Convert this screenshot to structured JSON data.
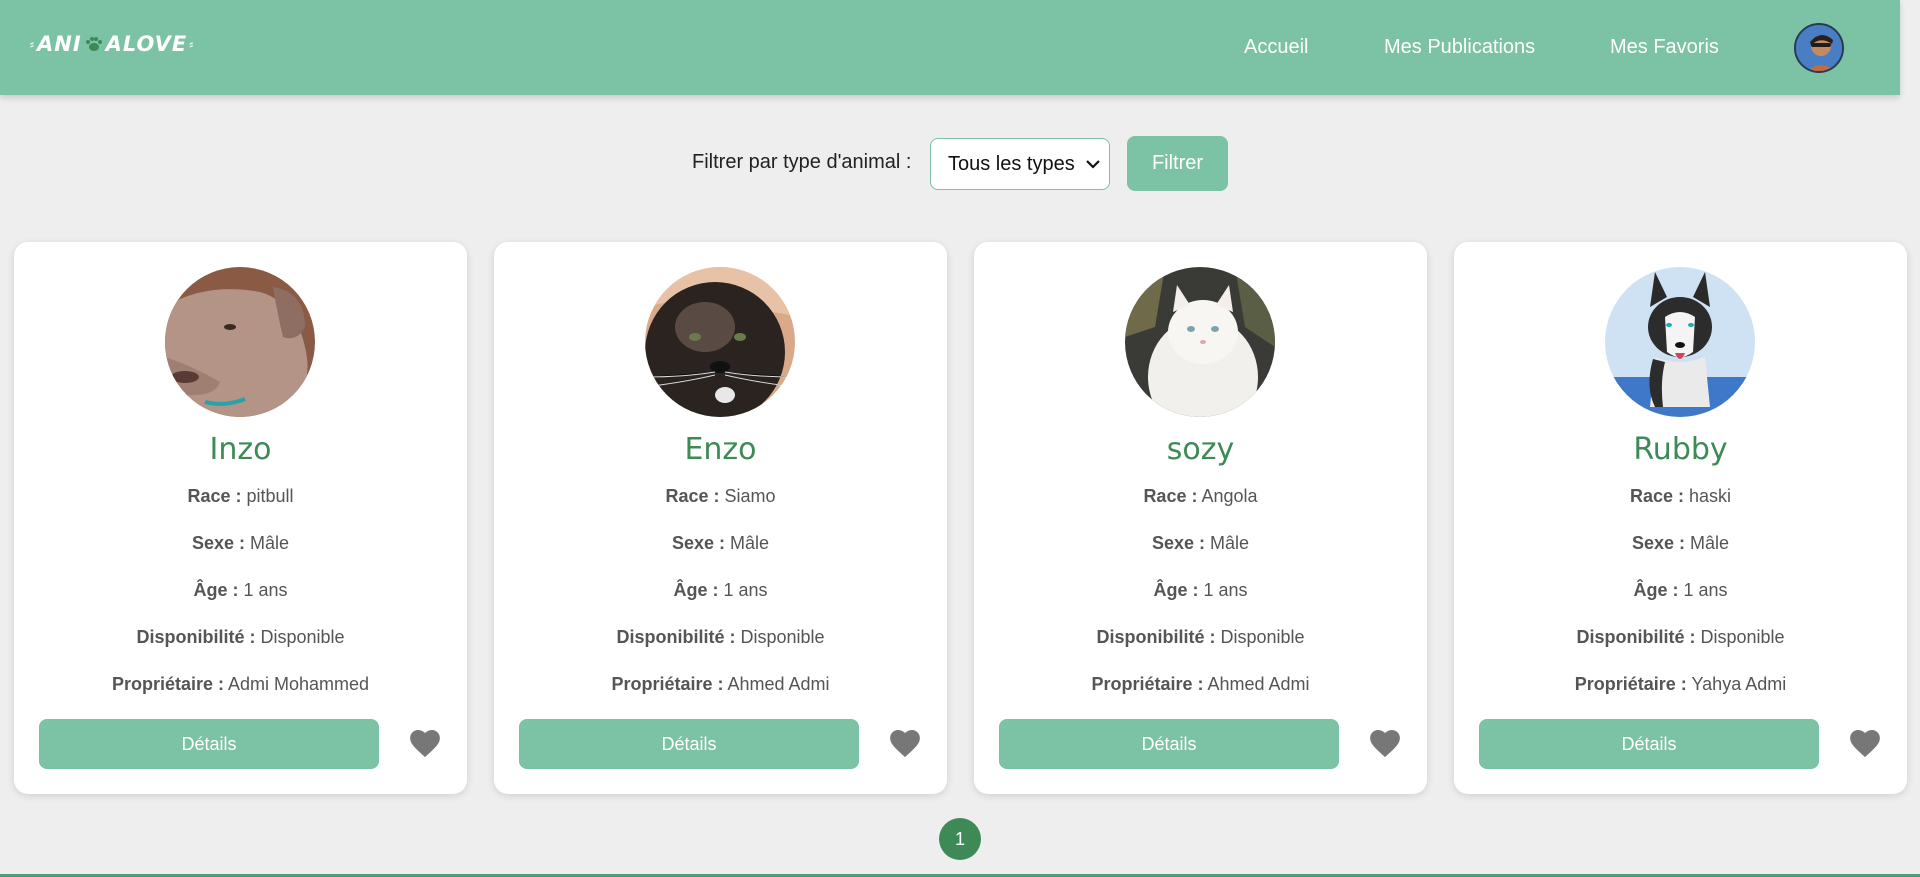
{
  "header": {
    "logo_text_left": "ANI",
    "logo_text_right": "ALOVE",
    "nav": [
      "Accueil",
      "Mes Publications",
      "Mes Favoris"
    ]
  },
  "filter": {
    "label": "Filtrer par type d'animal :",
    "selected": "Tous les types",
    "button": "Filtrer"
  },
  "labels": {
    "race": "Race :",
    "sexe": "Sexe :",
    "age": "Âge :",
    "dispo": "Disponibilité :",
    "owner": "Propriétaire :",
    "details": "Détails"
  },
  "animals": [
    {
      "name": "Inzo",
      "race": "pitbull",
      "sexe": "Mâle",
      "age": "1 ans",
      "dispo": "Disponible",
      "owner": "Admi Mohammed",
      "photo": "dog-pitbull"
    },
    {
      "name": "Enzo",
      "race": "Siamo",
      "sexe": "Mâle",
      "age": "1 ans",
      "dispo": "Disponible",
      "owner": "Ahmed Admi",
      "photo": "cat-siamese"
    },
    {
      "name": "sozy",
      "race": "Angola",
      "sexe": "Mâle",
      "age": "1 ans",
      "dispo": "Disponible",
      "owner": "Ahmed Admi",
      "photo": "cat-white"
    },
    {
      "name": "Rubby",
      "race": "haski",
      "sexe": "Mâle",
      "age": "1 ans",
      "dispo": "Disponible",
      "owner": "Yahya Admi",
      "photo": "dog-husky"
    }
  ],
  "pagination": {
    "current": "1"
  },
  "colors": {
    "primary": "#7cc2a5",
    "accent": "#3e8a57",
    "fav": "#777777"
  }
}
